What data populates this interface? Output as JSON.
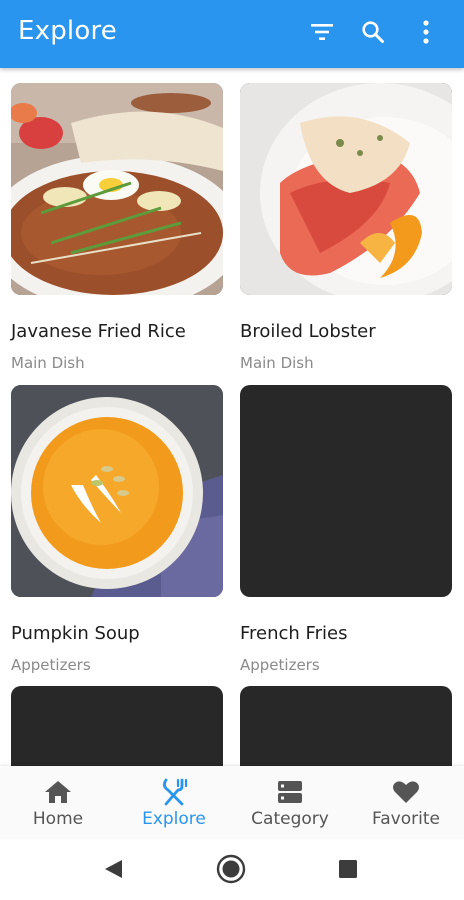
{
  "appbar": {
    "title": "Explore",
    "actions": [
      {
        "icon": "filter-icon"
      },
      {
        "icon": "search-icon"
      },
      {
        "icon": "more-vert-icon"
      }
    ],
    "background": "#2a95ee"
  },
  "recipes": [
    {
      "title": "Javanese Fried Rice",
      "category": "Main Dish",
      "image": "fried-rice-photo"
    },
    {
      "title": "Broiled Lobster",
      "category": "Main Dish",
      "image": "lobster-photo"
    },
    {
      "title": "Pumpkin Soup",
      "category": "Appetizers",
      "image": "pumpkin-soup-photo"
    },
    {
      "title": "French Fries",
      "category": "Appetizers",
      "image": "image-placeholder"
    },
    {
      "title": "",
      "category": "",
      "image": "image-placeholder"
    },
    {
      "title": "",
      "category": "",
      "image": "image-placeholder"
    }
  ],
  "bottom_nav": {
    "items": [
      {
        "label": "Home",
        "icon": "home-icon",
        "active": false
      },
      {
        "label": "Explore",
        "icon": "explore-icon",
        "active": true
      },
      {
        "label": "Category",
        "icon": "category-icon",
        "active": false
      },
      {
        "label": "Favorite",
        "icon": "heart-icon",
        "active": false
      }
    ],
    "active_color": "#2a95ee",
    "inactive_color": "#555555"
  },
  "system_nav": {
    "buttons": [
      {
        "icon": "back-icon"
      },
      {
        "icon": "home-circle-icon"
      },
      {
        "icon": "recents-icon"
      }
    ]
  }
}
